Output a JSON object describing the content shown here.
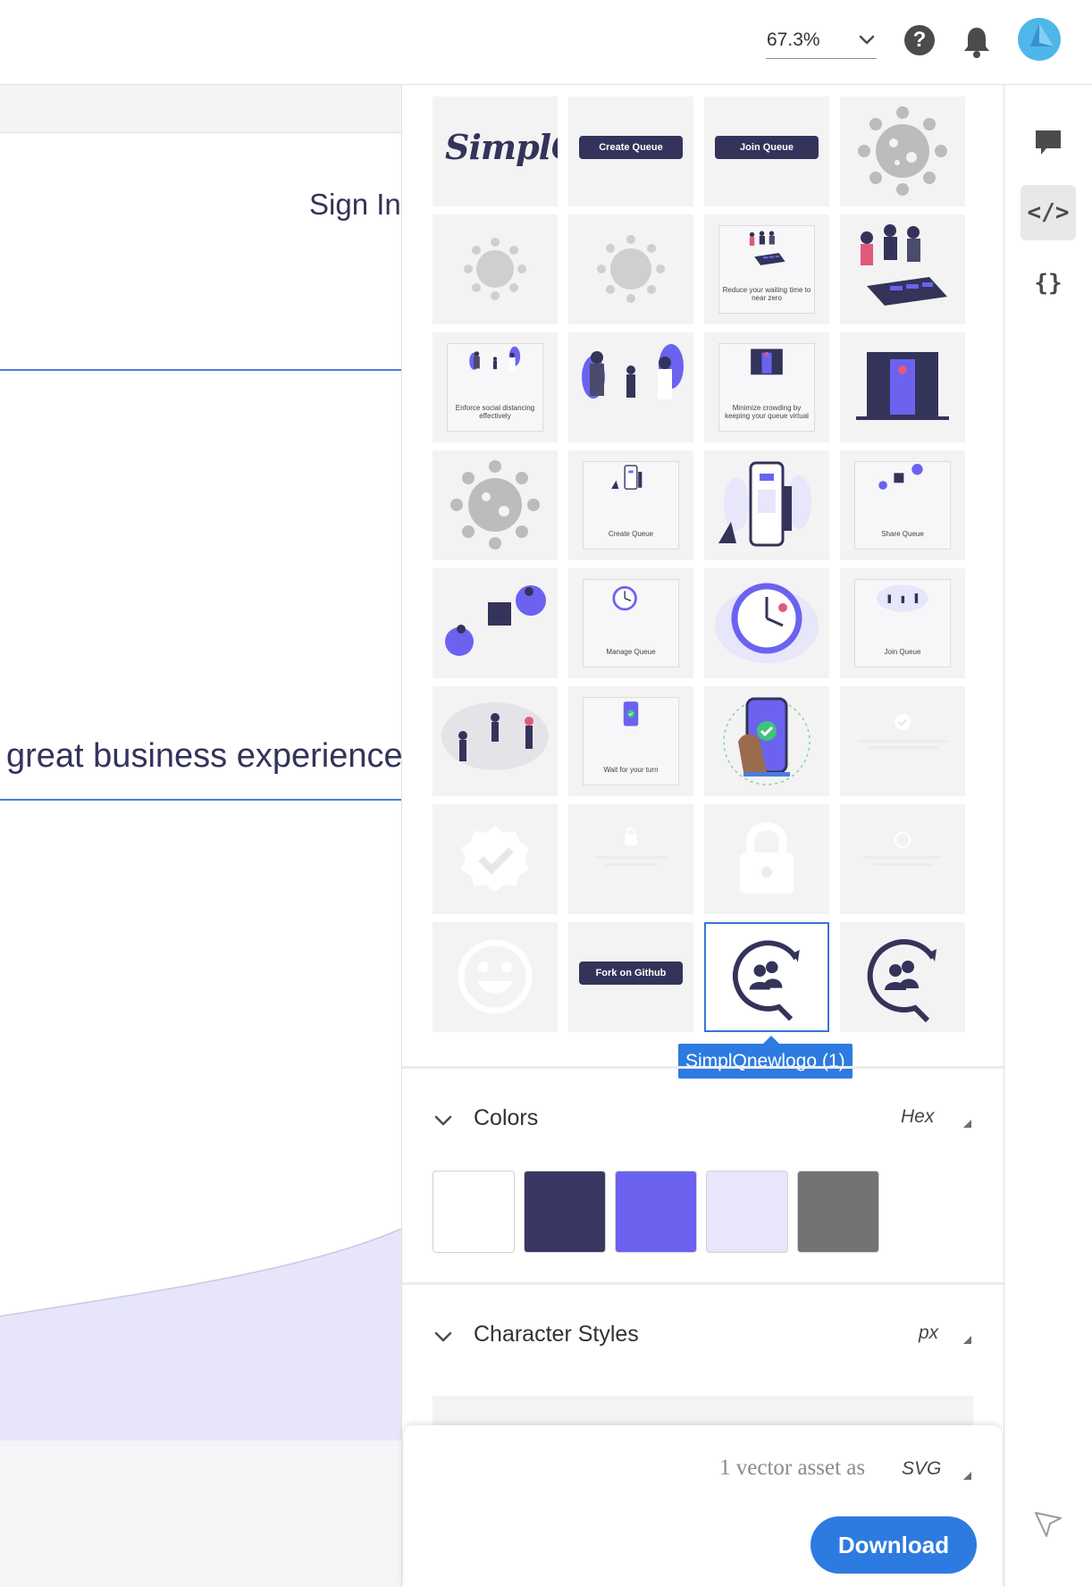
{
  "topbar": {
    "zoom_value": "67.3%",
    "help_label": "?",
    "icons": [
      "chevron-down-icon",
      "help-icon",
      "bell-icon",
      "avatar"
    ]
  },
  "canvas": {
    "signin_text": "Sign In",
    "headline_text": "great business experience"
  },
  "assets": {
    "tiles": [
      {
        "id": "simplq-logo",
        "text": "SimplQ"
      },
      {
        "id": "create-queue",
        "text": "Create Queue"
      },
      {
        "id": "join-queue",
        "text": "Join Queue"
      },
      {
        "id": "virus-1",
        "text": ""
      },
      {
        "id": "virus-2",
        "text": ""
      },
      {
        "id": "virus-3",
        "text": ""
      },
      {
        "id": "reduce-waiting-card",
        "text": "Reduce your waiting time to near zero"
      },
      {
        "id": "reduce-waiting-illustration",
        "text": ""
      },
      {
        "id": "social-distancing-card",
        "text": "Enforce social distancing effectively"
      },
      {
        "id": "social-distancing-illustration",
        "text": ""
      },
      {
        "id": "minimize-crowding-card",
        "text": "Minimize crowding by keeping your queue virtual"
      },
      {
        "id": "minimize-crowding-illustration",
        "text": ""
      },
      {
        "id": "virus-4",
        "text": ""
      },
      {
        "id": "create-queue-card",
        "text": "Create Queue"
      },
      {
        "id": "create-queue-illustration",
        "text": ""
      },
      {
        "id": "share-queue-card",
        "text": "Share Queue"
      },
      {
        "id": "share-queue-illustration",
        "text": ""
      },
      {
        "id": "manage-queue-card",
        "text": "Manage Queue"
      },
      {
        "id": "manage-queue-illustration",
        "text": ""
      },
      {
        "id": "join-queue-card",
        "text": "Join Queue"
      },
      {
        "id": "join-queue-illustration",
        "text": ""
      },
      {
        "id": "wait-for-turn-card",
        "text": "Wait for your turn"
      },
      {
        "id": "wait-for-turn-illustration",
        "text": ""
      },
      {
        "id": "faded-card-1",
        "text": ""
      },
      {
        "id": "badge-check",
        "text": ""
      },
      {
        "id": "faded-card-2",
        "text": ""
      },
      {
        "id": "lock",
        "text": ""
      },
      {
        "id": "faded-card-3",
        "text": ""
      },
      {
        "id": "smiley",
        "text": ""
      },
      {
        "id": "fork-on-github",
        "text": "Fork on Github"
      },
      {
        "id": "simplq-newlogo-1",
        "text": ""
      },
      {
        "id": "simplq-newlogo-2",
        "text": ""
      }
    ],
    "selected_tooltip": "SimplQnewlogo (1)"
  },
  "colors": {
    "title": "Colors",
    "unit": "Hex",
    "swatches": [
      "#ffffff",
      "#3a3764",
      "#6b63f0",
      "#e7e6fa",
      "#737373"
    ]
  },
  "character_styles": {
    "title": "Character Styles",
    "unit": "px"
  },
  "export": {
    "summary": "1 vector asset as",
    "format": "SVG",
    "download_label": "Download"
  },
  "rail": {
    "comment_icon": "comment-icon",
    "code_glyph": "</>",
    "braces_glyph": "{}",
    "pointer_icon": "pointer-icon"
  },
  "theme": {
    "accent": "#2d7be0",
    "brand_dark": "#34335a",
    "brand_purple": "#6b63f0",
    "brand_light": "#e7e6fa"
  }
}
